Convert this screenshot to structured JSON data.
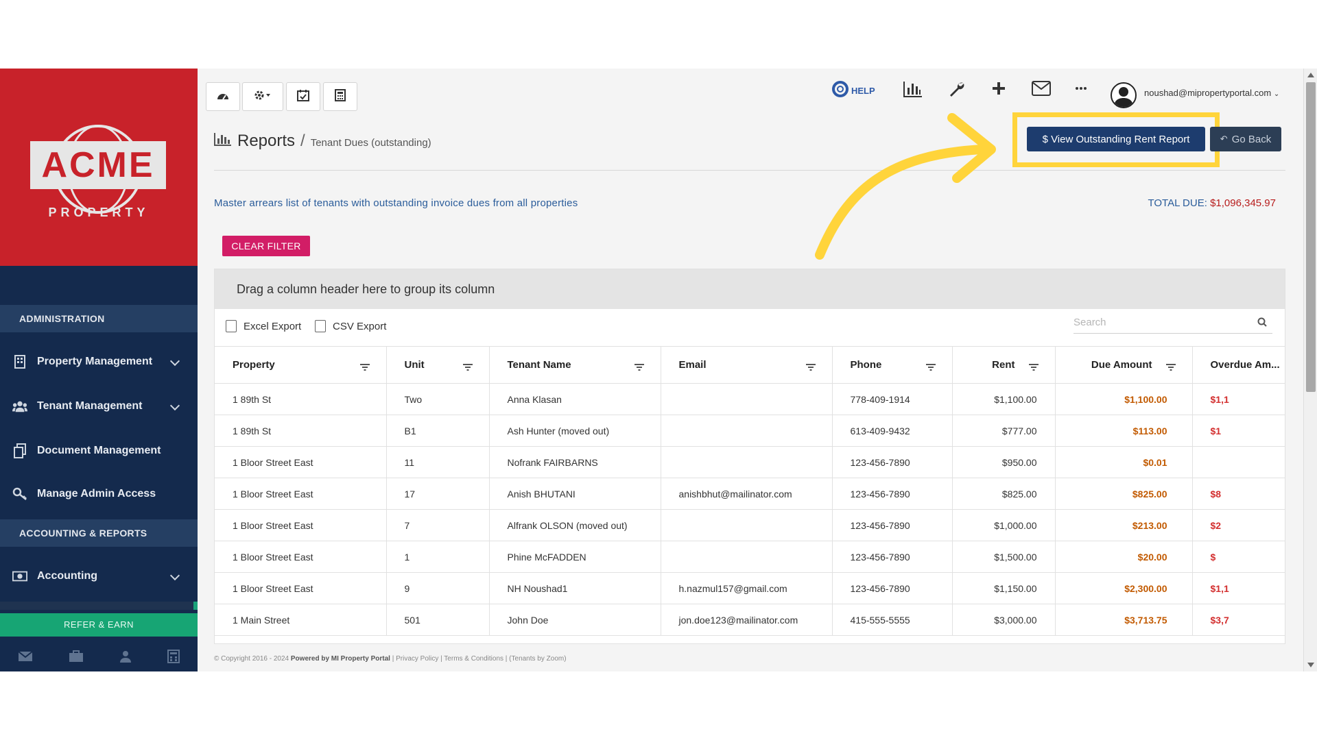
{
  "brand": {
    "logo_text": "ACME",
    "logo_sub": "PROPERTY",
    "colors": {
      "logo_bg": "#c8222a",
      "sidebar": "#142a4d",
      "accent_pink": "#d21d66",
      "primary_button": "#1d3c6e",
      "highlight": "#ffd43b",
      "refer_green": "#17a574"
    }
  },
  "sidebar": {
    "sections": [
      {
        "label": "ADMINISTRATION"
      },
      {
        "label": "ACCOUNTING & REPORTS"
      }
    ],
    "items": [
      {
        "label": "Property Management",
        "icon": "building-icon",
        "expandable": true
      },
      {
        "label": "Tenant Management",
        "icon": "users-icon",
        "expandable": true
      },
      {
        "label": "Document Management",
        "icon": "documents-icon",
        "expandable": false
      },
      {
        "label": "Manage Admin Access",
        "icon": "key-icon",
        "expandable": false
      },
      {
        "label": "Accounting",
        "icon": "money-icon",
        "expandable": true
      }
    ],
    "refer_label": "REFER & EARN",
    "bottom_icons": [
      "mail-icon",
      "briefcase-icon",
      "user-icon",
      "calculator-icon"
    ]
  },
  "topbar": {
    "left_buttons": [
      "dashboard-icon",
      "settings-icon",
      "calendar-check-icon",
      "calculator-icon"
    ],
    "help_label": "HELP",
    "right_icons": [
      "chart-icon",
      "wrench-icon",
      "plus-icon",
      "envelope-icon",
      "more-icon"
    ],
    "user_email": "noushad@mipropertyportal.com"
  },
  "page": {
    "title": "Reports",
    "breadcrumb_sub": "Tenant Dues (outstanding)",
    "view_report_label": "$ View Outstanding Rent Report",
    "go_back_label": "Go Back",
    "description": "Master arrears list of tenants with outstanding invoice dues from all properties",
    "total_label": "TOTAL DUE:",
    "total_value": "$1,096,345.97",
    "clear_filter_label": "CLEAR FILTER"
  },
  "grid": {
    "group_hint": "Drag a column header here to group its column",
    "excel_export": "Excel Export",
    "csv_export": "CSV Export",
    "search_placeholder": "Search",
    "columns": [
      "Property",
      "Unit",
      "Tenant Name",
      "Email",
      "Phone",
      "Rent",
      "Due Amount",
      "Overdue Am..."
    ],
    "rows": [
      {
        "property": "1 89th St",
        "unit": "Two",
        "tenant": "Anna Klasan",
        "email": "",
        "phone": "778-409-1914",
        "rent": "$1,100.00",
        "due": "$1,100.00",
        "overdue": "$1,1"
      },
      {
        "property": "1 89th St",
        "unit": "B1",
        "tenant": "Ash Hunter (moved out)",
        "email": "",
        "phone": "613-409-9432",
        "rent": "$777.00",
        "due": "$113.00",
        "overdue": "$1"
      },
      {
        "property": "1 Bloor Street East",
        "unit": "11",
        "tenant": "Nofrank FAIRBARNS",
        "email": "",
        "phone": "123-456-7890",
        "rent": "$950.00",
        "due": "$0.01",
        "overdue": ""
      },
      {
        "property": "1 Bloor Street East",
        "unit": "17",
        "tenant": "Anish BHUTANI",
        "email": "anishbhut@mailinator.com",
        "phone": "123-456-7890",
        "rent": "$825.00",
        "due": "$825.00",
        "overdue": "$8"
      },
      {
        "property": "1 Bloor Street East",
        "unit": "7",
        "tenant": "Alfrank OLSON (moved out)",
        "email": "",
        "phone": "123-456-7890",
        "rent": "$1,000.00",
        "due": "$213.00",
        "overdue": "$2"
      },
      {
        "property": "1 Bloor Street East",
        "unit": "1",
        "tenant": "Phine McFADDEN",
        "email": "",
        "phone": "123-456-7890",
        "rent": "$1,500.00",
        "due": "$20.00",
        "overdue": "$"
      },
      {
        "property": "1 Bloor Street East",
        "unit": "9",
        "tenant": "NH Noushad1",
        "email": "h.nazmul157@gmail.com",
        "phone": "123-456-7890",
        "rent": "$1,150.00",
        "due": "$2,300.00",
        "overdue": "$1,1"
      },
      {
        "property": "1 Main Street",
        "unit": "501",
        "tenant": "John Doe",
        "email": "jon.doe123@mailinator.com",
        "phone": "415-555-5555",
        "rent": "$3,000.00",
        "due": "$3,713.75",
        "overdue": "$3,7"
      }
    ]
  },
  "footer": {
    "copyright": "© Copyright 2016 - 2024",
    "powered": "Powered by MI Property Portal",
    "links": "| Privacy Policy | Terms & Conditions |",
    "tag": "(Tenants by Zoom)"
  }
}
